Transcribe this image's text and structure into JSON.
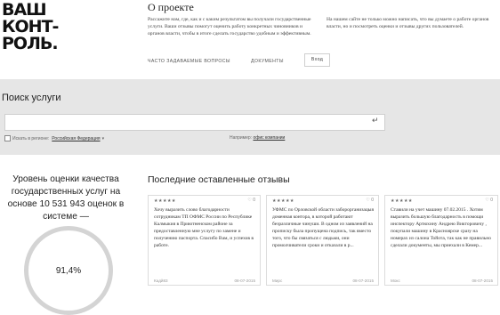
{
  "logo": {
    "lines": [
      "ВАШ",
      "КОНТ-",
      "РОЛЬ."
    ]
  },
  "about": {
    "title": "О проекте",
    "text": "Рассажите нам, где, как и с каким результатом вы получали государственные услуги. Ваши отзывы помогут оценить работу конкретных чиновников и органов власти, чтобы в итоге сделать государство удобным и эффективным."
  },
  "side_text": "На нашем сайте не только можно написать, что вы думаете о работе органов власти, но и посмотреть оценки и отзывы других пользователей.",
  "nav": {
    "faq": "Часто задаваемые вопросы",
    "documents": "Документы",
    "login": "Вход"
  },
  "search": {
    "title": "Поиск услуги",
    "enter_icon": "↵",
    "region_label": "Искать в регионе:",
    "region_value": "Российская Федерация",
    "example_label": "Например:",
    "example_value": "офис компании"
  },
  "stat": {
    "title": "Уровень оценки качества государственных услуг на основе 10 531 943 оценок в системе —",
    "value": "91,4%"
  },
  "reviews": {
    "title": "Последние оставленные отзывы",
    "items": [
      {
        "stars": "★★★★★",
        "comments": "♡ 0",
        "text": "Хочу выразить слово благодарности сотрудникам ТП ОФМС России по Республике Калмыкия в Приютненском районе за предоставленную мне услугу по замене и получению паспорта. Спасибо Вам, и успехов в работе.",
        "author": "Кадй83",
        "date": "08-07-2015"
      },
      {
        "stars": "★★★★★",
        "comments": "♡ 0",
        "text": "УФМС по Орловской области заборорганизацыя доменная контора, в которой работают безразличные чинуши. В одном из заявлений на прописку была пропущена подпись, так вместо того, что бы связаться с людьми, они промолчиватели сроки и отказали в р...",
        "author": "Мирс",
        "date": "08-07-2015"
      },
      {
        "stars": "★★★★★",
        "comments": "♡ 0",
        "text": "Ставили на учет машину 07.02.2015 . Хотим выразить большую благодарность в помощи инспектору Артюхину Андрею Викторовичу , покупали машину в Красноярске сразу на номерах из салона Тойота, так как не правильно сделали документы, мы приехали в Кемер...",
        "author": "Мокс",
        "date": "08-07-2015"
      }
    ]
  },
  "colors": {
    "band": "#e6e6e6",
    "gauge_track": "#d4d4d4",
    "text": "#222222"
  }
}
